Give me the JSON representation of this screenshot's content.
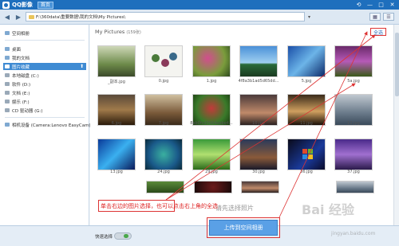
{
  "titlebar": {
    "app_title": "QQ影像",
    "home_tab": "首页",
    "controls": [
      "⟲",
      "—",
      "□",
      "✕"
    ]
  },
  "addrbar": {
    "back_icon": "◀",
    "forward_icon": "▶",
    "path": "F:\\360data\\重要数据\\我的文档\\My Pictures\\",
    "view_grid_icon": "▦",
    "view_list_icon": "☰"
  },
  "sidebar": {
    "items": [
      {
        "label": "空间相册",
        "icon": "album-icon"
      },
      {
        "label": "桌面",
        "icon": "desktop-icon"
      },
      {
        "label": "我的文档",
        "icon": "documents-icon"
      },
      {
        "label": "图片收藏",
        "icon": "pictures-icon",
        "selected": true
      },
      {
        "label": "本地磁盘 (C:)",
        "icon": "drive-icon"
      },
      {
        "label": "软件 (D:)",
        "icon": "drive-icon"
      },
      {
        "label": "文档 (E:)",
        "icon": "drive-icon"
      },
      {
        "label": "娱乐 (F:)",
        "icon": "drive-icon"
      },
      {
        "label": "CD 驱动器 (G:)",
        "icon": "cd-drive-icon"
      },
      {
        "label": "相机设备 (Camera:Lenovo EasyCam)",
        "icon": "camera-icon"
      }
    ]
  },
  "main": {
    "folder_title": "My Pictures",
    "count": "(159张)",
    "select_all": "全选",
    "thumbnails": [
      {
        "label": "_副本.jpg"
      },
      {
        "label": "0.jpg"
      },
      {
        "label": "1.jpg"
      },
      {
        "label": "4f8a3b1ad5d65dd..."
      },
      {
        "label": "5.jpg"
      },
      {
        "label": "5a.jpg"
      },
      {
        "label": "6.jpg"
      },
      {
        "label": "7.jpg"
      },
      {
        "label": "8ab0fcd3564ebbe4..."
      },
      {
        "label": "10.jpg"
      },
      {
        "label": "11.jpg"
      },
      {
        "label": "12.jpg"
      },
      {
        "label": "13.jpg"
      },
      {
        "label": "24.jpg"
      },
      {
        "label": "29.jpg"
      },
      {
        "label": "30.jpg"
      },
      {
        "label": "36.jpg"
      },
      {
        "label": "37.jpg"
      }
    ]
  },
  "bottombar": {
    "quick_select_label": "快速选择",
    "hint": "请先选择照片",
    "upload_button": "上传到空间相册"
  },
  "annotation": {
    "text": "单击右边的图片选择，也可以点击右上角的全选"
  },
  "watermark": {
    "main": "Bai 经验",
    "sub": "jingyan.baidu.com"
  }
}
